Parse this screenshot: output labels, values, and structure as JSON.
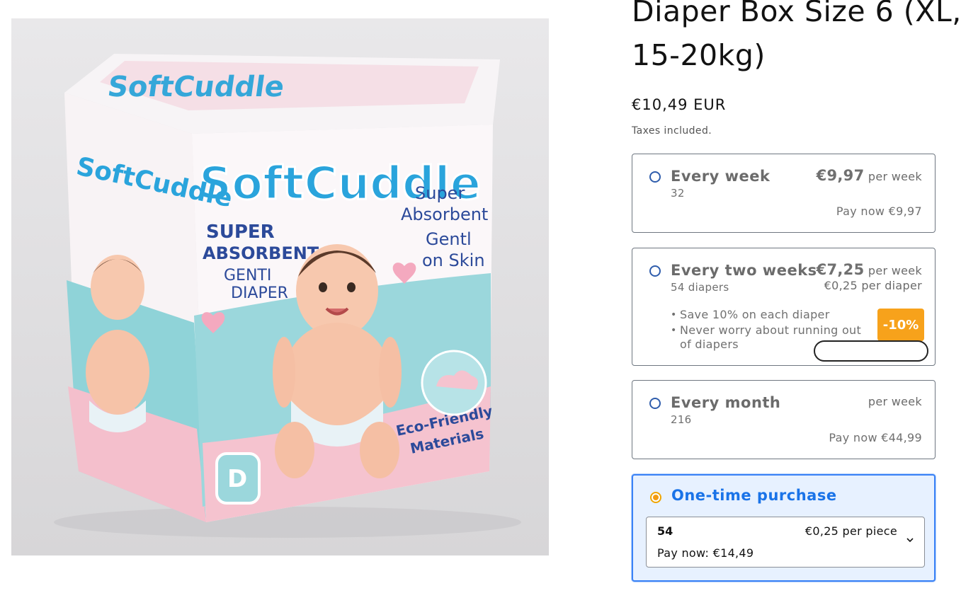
{
  "product": {
    "title": "Diaper Box Size 6 (XL, 15-20kg)",
    "price": "€10,49 EUR",
    "tax_note": "Taxes included.",
    "image": {
      "brand_text": "SoftCuddle",
      "labels": [
        "SUPER ABSORBENT",
        "GENTI DIAPER",
        "Super Absorbent",
        "Gentl on Skin",
        "Eco-Friendly Materials"
      ]
    }
  },
  "options": [
    {
      "name": "Every week",
      "subtitle": "32",
      "price": "€9,97",
      "price_unit": "per week",
      "pay_now": "Pay now €9,97",
      "selected": false
    },
    {
      "name": "Every two weeks",
      "subtitle": "54 diapers",
      "price": "€7,25",
      "price_unit": "per week",
      "per_item": "€0,25 per diaper",
      "bullets": [
        "Save 10% on each diaper",
        "Never worry about running out of diapers"
      ],
      "badge": "-10%",
      "selected": false
    },
    {
      "name": "Every month",
      "subtitle": "216",
      "price_unit": "per week",
      "pay_now": "Pay now €44,99",
      "selected": false
    },
    {
      "name": "One-time purchase",
      "selected": true,
      "select": {
        "quantity": "54",
        "unit_price": "€0,25 per piece",
        "pay_now": "Pay now: €14,49"
      }
    }
  ],
  "colors": {
    "accent_blue": "#1a73e8",
    "selected_bg": "#e7f1ff",
    "badge_orange": "#f7a21b",
    "radio_selected": "#f39c12"
  },
  "icons": {
    "select_chevron": "chevron-down-icon"
  }
}
